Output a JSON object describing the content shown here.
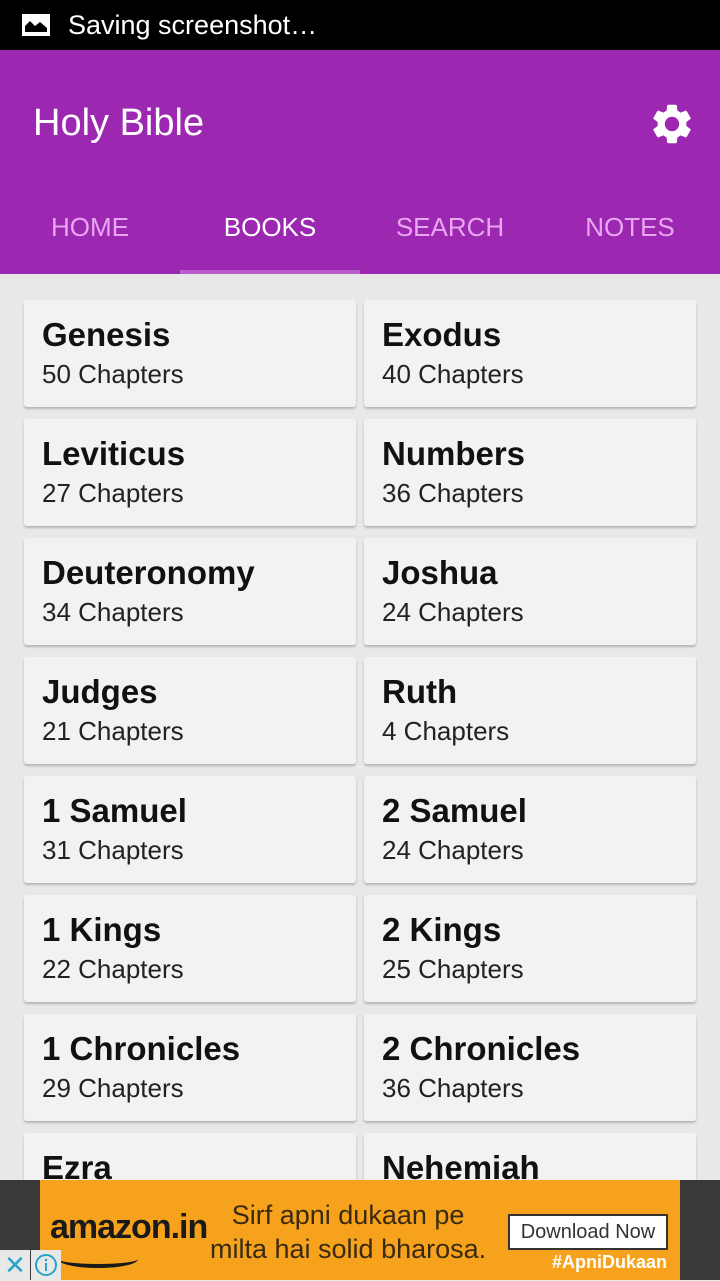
{
  "status_bar": {
    "icon": "image-icon",
    "text": "Saving screenshot…"
  },
  "app_bar": {
    "title": "Holy Bible",
    "settings_icon": "gear-icon"
  },
  "tabs": [
    {
      "label": "HOME",
      "active": false
    },
    {
      "label": "BOOKS",
      "active": true
    },
    {
      "label": "SEARCH",
      "active": false
    },
    {
      "label": "NOTES",
      "active": false
    }
  ],
  "books": [
    {
      "name": "Genesis",
      "chapters": "50 Chapters"
    },
    {
      "name": "Exodus",
      "chapters": "40 Chapters"
    },
    {
      "name": "Leviticus",
      "chapters": "27 Chapters"
    },
    {
      "name": "Numbers",
      "chapters": "36 Chapters"
    },
    {
      "name": "Deuteronomy",
      "chapters": "34 Chapters"
    },
    {
      "name": "Joshua",
      "chapters": "24 Chapters"
    },
    {
      "name": "Judges",
      "chapters": "21 Chapters"
    },
    {
      "name": "Ruth",
      "chapters": "4 Chapters"
    },
    {
      "name": "1 Samuel",
      "chapters": "31 Chapters"
    },
    {
      "name": "2 Samuel",
      "chapters": "24 Chapters"
    },
    {
      "name": "1 Kings",
      "chapters": "22 Chapters"
    },
    {
      "name": "2 Kings",
      "chapters": "25 Chapters"
    },
    {
      "name": "1 Chronicles",
      "chapters": "29 Chapters"
    },
    {
      "name": "2 Chronicles",
      "chapters": "36 Chapters"
    },
    {
      "name": "Ezra",
      "chapters": ""
    },
    {
      "name": "Nehemiah",
      "chapters": ""
    }
  ],
  "ad": {
    "brand": "amazon.in",
    "line1": "Sirf apni dukaan pe",
    "line2": "milta hai solid bharosa.",
    "button": "Download Now",
    "hashtag": "#ApniDukaan",
    "close_icon": "close-icon",
    "info_icon": "info-icon"
  }
}
